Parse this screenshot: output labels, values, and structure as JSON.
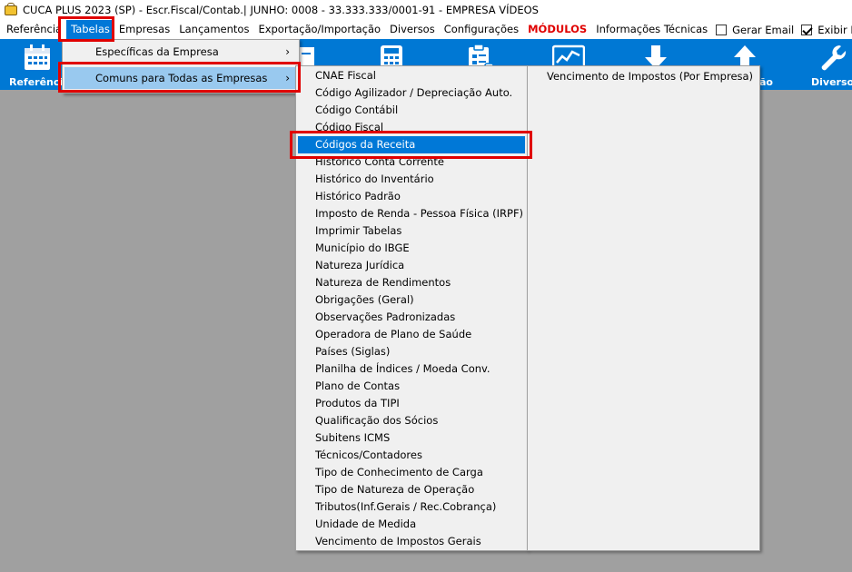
{
  "window": {
    "title": "CUCA PLUS 2023 (SP) - Escr.Fiscal/Contab.| JUNHO: 0008 - 33.333.333/0001-91 - EMPRESA VÍDEOS"
  },
  "menubar": {
    "items": [
      "Referência",
      "Tabelas",
      "Empresas",
      "Lançamentos",
      "Exportação/Importação",
      "Diversos",
      "Configurações",
      "MÓDULOS",
      "Informações Técnicas"
    ],
    "active": "Tabelas",
    "checks": [
      {
        "label": "Gerar Email",
        "checked": false
      },
      {
        "label": "Exibir Barra de F",
        "checked": true
      }
    ]
  },
  "toolbar": {
    "items": [
      {
        "label": "Referência",
        "icon": "calendar-icon"
      },
      {
        "label": "",
        "icon": "document-icon"
      },
      {
        "label": "",
        "icon": "calculator-icon"
      },
      {
        "label": "",
        "icon": "clipboard-icon"
      },
      {
        "label": "",
        "icon": "chart-icon"
      },
      {
        "label": "",
        "icon": "download-arrow-icon"
      },
      {
        "label": "ão",
        "icon": "upload-arrow-icon"
      },
      {
        "label": "Diversos",
        "icon": "wrench-icon"
      }
    ],
    "accent": "#0078d4"
  },
  "tabelas_menu": {
    "items": [
      {
        "label": "Específicas da Empresa",
        "submenu": true
      },
      {
        "label": "Comuns para Todas as Empresas",
        "submenu": true,
        "highlighted": true
      }
    ]
  },
  "comuns_menu": {
    "items": [
      "CNAE Fiscal",
      "Código Agilizador / Depreciação Auto.",
      "Código Contábil",
      "Código Fiscal",
      "Códigos da Receita",
      "Histórico Conta Corrente",
      "Histórico do Inventário",
      "Histórico Padrão",
      "Imposto de Renda - Pessoa Física (IRPF)",
      "Imprimir Tabelas",
      "Município do IBGE",
      "Natureza Jurídica",
      "Natureza de Rendimentos",
      "Obrigações (Geral)",
      "Observações Padronizadas",
      "Operadora de Plano de Saúde",
      "Países (Siglas)",
      "Planilha de Índices / Moeda Conv.",
      "Plano de Contas",
      "Produtos da TIPI",
      "Qualificação dos Sócios",
      "Subitens ICMS",
      "Técnicos/Contadores",
      "Tipo de Conhecimento de Carga",
      "Tipo de Natureza de Operação",
      "Tributos(Inf.Gerais / Rec.Cobrança)",
      "Unidade de Medida",
      "Vencimento de Impostos Gerais"
    ],
    "selected": "Códigos da Receita"
  },
  "extra_menu": {
    "items": [
      "Vencimento de Impostos (Por Empresa)"
    ]
  },
  "colors": {
    "highlight": "#0078d7",
    "hover": "#99c9ef",
    "annotation": "#e00000",
    "modulos": "#e00000"
  }
}
